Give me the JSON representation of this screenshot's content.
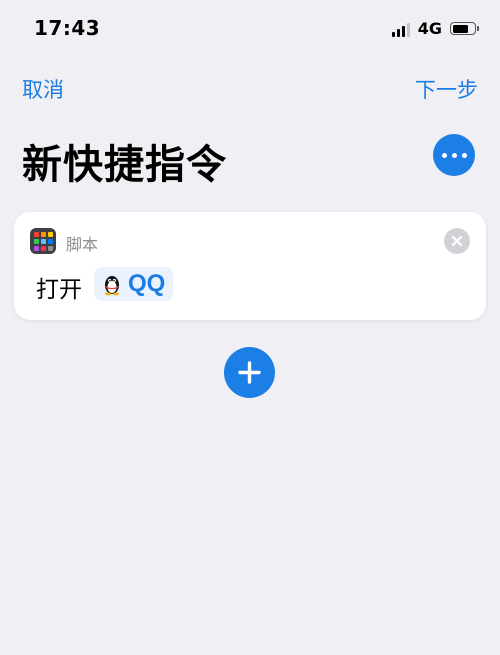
{
  "status_bar": {
    "time": "17:43",
    "network": "4G",
    "signal_bars_active": 3,
    "battery_level": 0.75
  },
  "nav": {
    "cancel_label": "取消",
    "next_label": "下一步"
  },
  "page": {
    "title": "新快捷指令"
  },
  "action_card": {
    "category_label": "脚本",
    "category_icon": "grid-apps-icon",
    "verb": "打开",
    "app_name": "QQ",
    "app_icon": "qq-penguin-icon",
    "remove_icon": "close-icon"
  },
  "more_icon": "ellipsis-icon",
  "add_icon": "plus-icon",
  "colors": {
    "accent": "#1A7DE5",
    "background": "#EFEFF4",
    "card": "#FFFFFF",
    "secondary_text": "#8E8E93",
    "token_background": "#EAF3FD"
  }
}
